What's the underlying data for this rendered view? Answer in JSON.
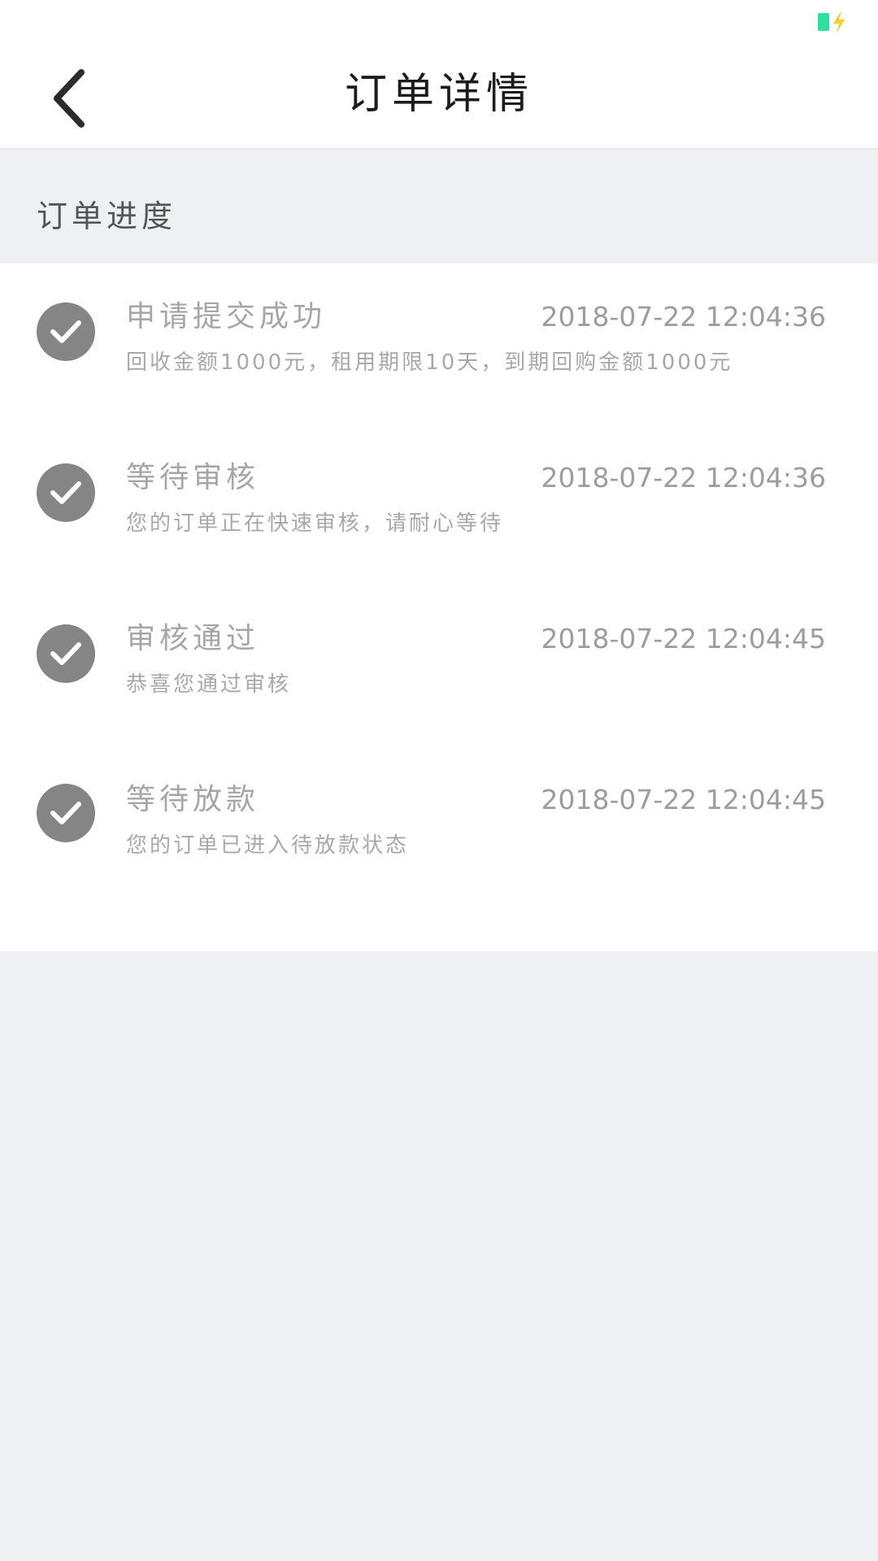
{
  "status_bar": {
    "battery_icon": "battery-icon",
    "charging_icon": "charging-bolt-icon",
    "battery_color": "#2fe0a0",
    "bolt_color": "#f5cf2e"
  },
  "header": {
    "title": "订单详情",
    "back_icon": "chevron-left-icon"
  },
  "section": {
    "title": "订单进度"
  },
  "steps": [
    {
      "title": "申请提交成功",
      "time": "2018-07-22 12:04:36",
      "desc": "回收金额1000元，租用期限10天，到期回购金额1000元",
      "icon": "check-circle-icon"
    },
    {
      "title": "等待审核",
      "time": "2018-07-22 12:04:36",
      "desc": "您的订单正在快速审核，请耐心等待",
      "icon": "check-circle-icon"
    },
    {
      "title": "审核通过",
      "time": "2018-07-22 12:04:45",
      "desc": "恭喜您通过审核",
      "icon": "check-circle-icon"
    },
    {
      "title": "等待放款",
      "time": "2018-07-22 12:04:45",
      "desc": "您的订单已进入待放款状态",
      "icon": "check-circle-icon"
    }
  ]
}
